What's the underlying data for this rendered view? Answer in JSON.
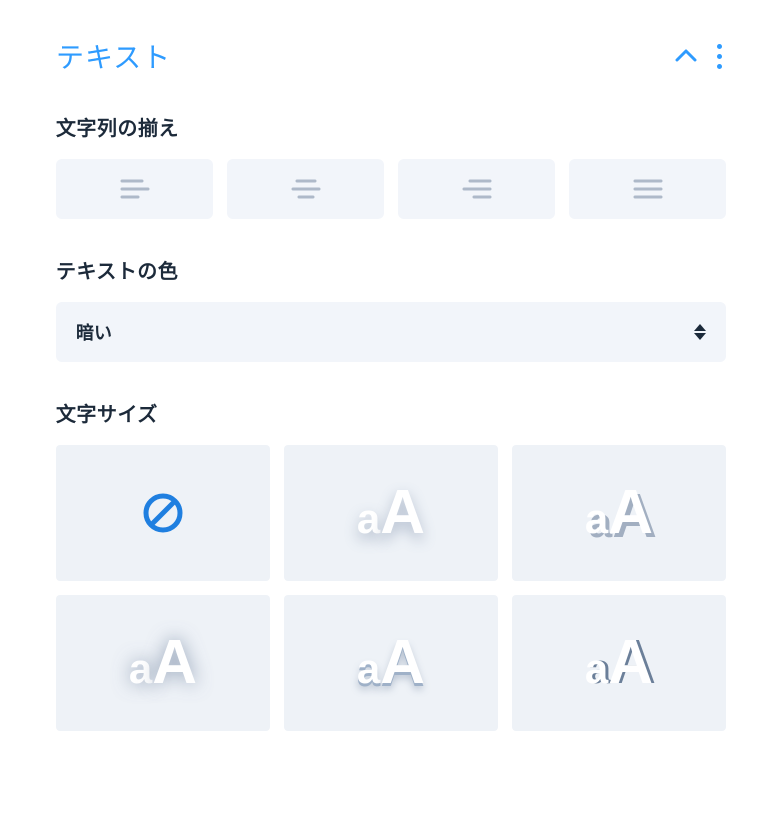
{
  "panel": {
    "title": "テキスト"
  },
  "sections": {
    "alignment": {
      "label": "文字列の揃え"
    },
    "textColor": {
      "label": "テキストの色",
      "selected": "暗い"
    },
    "fontSize": {
      "label": "文字サイズ"
    }
  },
  "glyph": {
    "a": "a",
    "A": "A"
  }
}
